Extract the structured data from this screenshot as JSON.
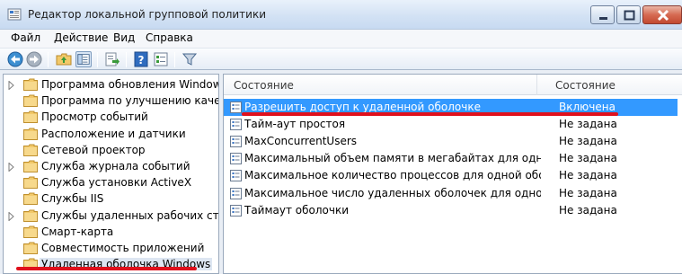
{
  "window": {
    "title": "Редактор локальной групповой политики"
  },
  "menu": {
    "items": [
      "Файл",
      "Действие",
      "Вид",
      "Справка"
    ]
  },
  "toolbar": {
    "buttons": [
      "back-icon",
      "forward-icon",
      "up-folder-icon",
      "show-hide-tree-icon",
      "export-list-icon",
      "help-icon",
      "properties-icon",
      "filter-icon"
    ]
  },
  "tree": {
    "items": [
      {
        "label": "Программа обновления Windows",
        "expandable": true
      },
      {
        "label": "Программа по улучшению каче",
        "expandable": false
      },
      {
        "label": "Просмотр событий",
        "expandable": false
      },
      {
        "label": "Расположение и датчики",
        "expandable": false
      },
      {
        "label": "Сетевой проектор",
        "expandable": false
      },
      {
        "label": "Служба журнала событий",
        "expandable": true
      },
      {
        "label": "Служба установки ActiveX",
        "expandable": false
      },
      {
        "label": "Службы IIS",
        "expandable": false
      },
      {
        "label": "Службы удаленных рабочих стол",
        "expandable": true
      },
      {
        "label": "Смарт-карта",
        "expandable": false
      },
      {
        "label": "Совместимость приложений",
        "expandable": false
      },
      {
        "label": "Удаленная оболочка Windows",
        "expandable": false,
        "selected": true
      }
    ]
  },
  "list": {
    "columns": {
      "name": "Состояние",
      "state": "Состояние"
    },
    "rows": [
      {
        "name": "Разрешить доступ к удаленной оболочке",
        "state": "Включена",
        "selected": true
      },
      {
        "name": "Тайм-аут простоя",
        "state": "Не задана"
      },
      {
        "name": "MaxConcurrentUsers",
        "state": "Не задана"
      },
      {
        "name": "Максимальный объем памяти в мегабайтах для одной о",
        "state": "Не задана"
      },
      {
        "name": "Максимальное количество процессов для одной оболоч",
        "state": "Не задана"
      },
      {
        "name": "Максимальное число удаленных оболочек для одного п",
        "state": "Не задана"
      },
      {
        "name": "Таймаут оболочки",
        "state": "Не задана"
      }
    ]
  },
  "colors": {
    "selection": "#3399ff",
    "annotation": "#e0101c",
    "folder": "#f2c96a"
  }
}
